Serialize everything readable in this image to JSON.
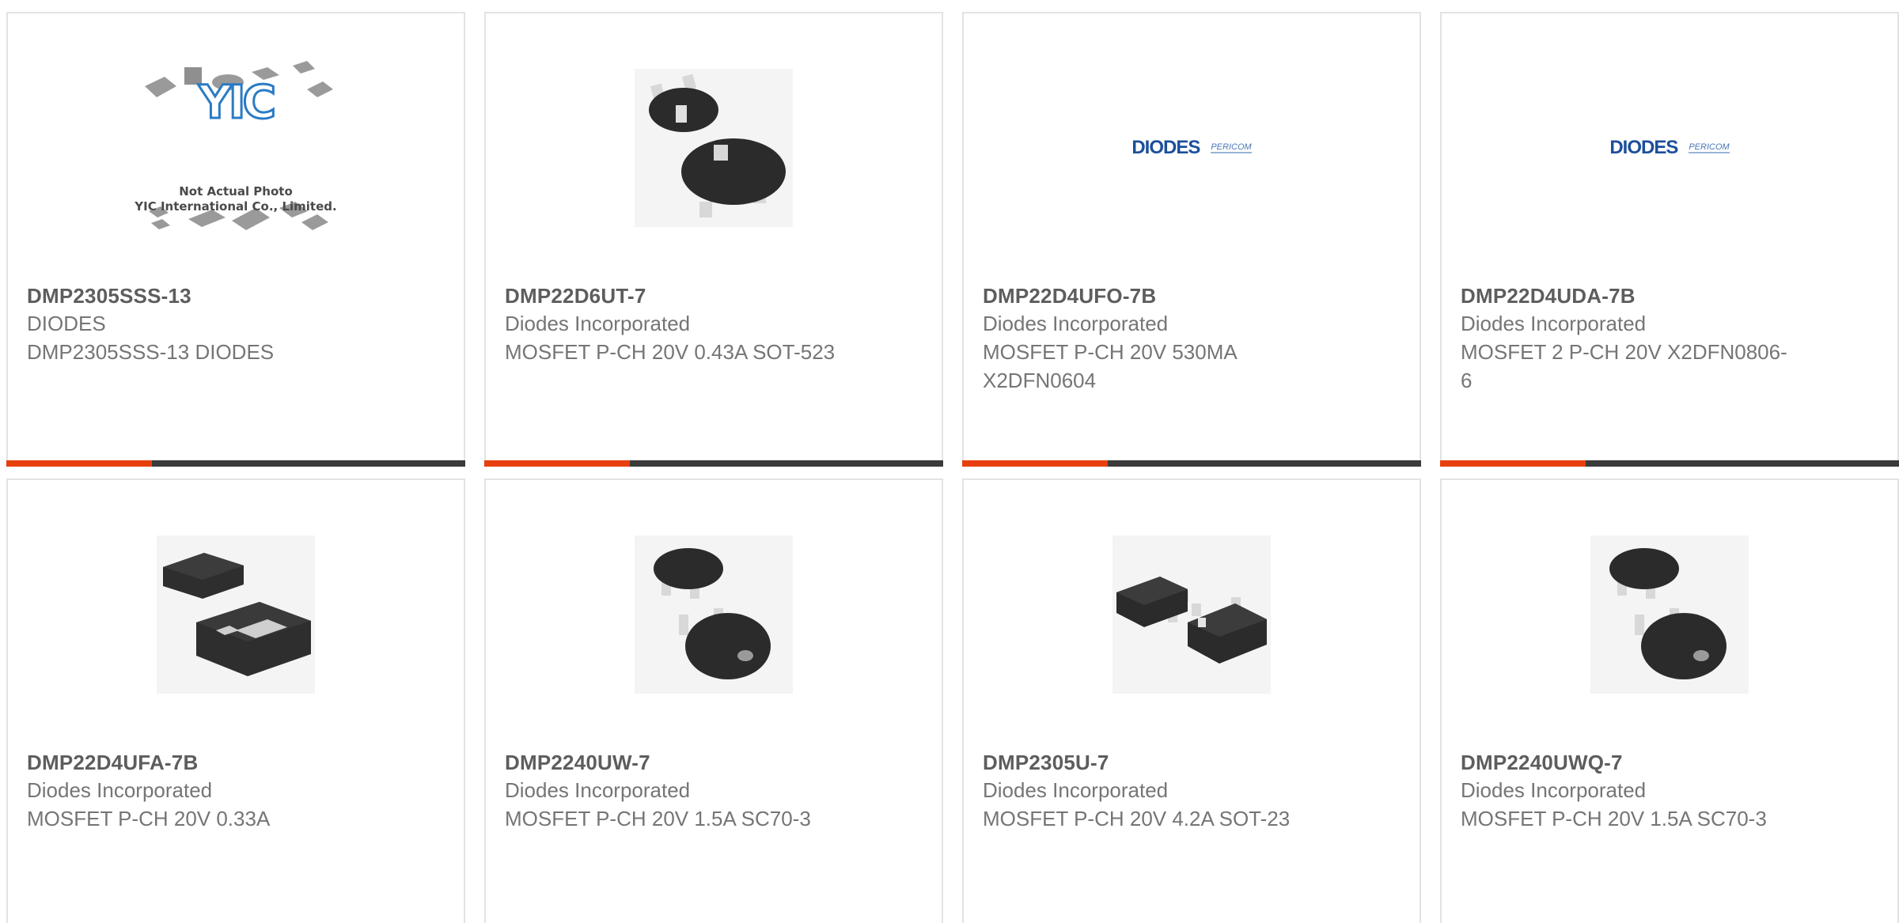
{
  "products": [
    {
      "name": "DMP2305SSS-13",
      "manufacturer": "DIODES",
      "description": "DMP2305SSS-13 DIODES",
      "image": "yic-placeholder",
      "placeholder_line1": "Not Actual Photo",
      "placeholder_line2": "YIC International Co., Limited.",
      "placeholder_logo": "YIC"
    },
    {
      "name": "DMP22D6UT-7",
      "manufacturer": "Diodes Incorporated",
      "description": "MOSFET P-CH 20V 0.43A SOT-523",
      "image": "sot523-package"
    },
    {
      "name": "DMP22D4UFO-7B",
      "manufacturer": "Diodes Incorporated",
      "description": "MOSFET P-CH 20V 530MA X2DFN0604",
      "image": "diodes-pericom-logo",
      "logo_left": "DIODES",
      "logo_right": "PERICOM"
    },
    {
      "name": "DMP22D4UDA-7B",
      "manufacturer": "Diodes Incorporated",
      "description": "MOSFET 2 P-CH 20V X2DFN0806-6",
      "image": "diodes-pericom-logo",
      "logo_left": "DIODES",
      "logo_right": "PERICOM"
    },
    {
      "name": "DMP22D4UFA-7B",
      "manufacturer": "Diodes Incorporated",
      "description": "MOSFET P-CH 20V 0.33A",
      "image": "dfn-package"
    },
    {
      "name": "DMP2240UW-7",
      "manufacturer": "Diodes Incorporated",
      "description": "MOSFET P-CH 20V 1.5A SC70-3",
      "image": "sc70-package"
    },
    {
      "name": "DMP2305U-7",
      "manufacturer": "Diodes Incorporated",
      "description": "MOSFET P-CH 20V 4.2A SOT-23",
      "image": "sot23-package"
    },
    {
      "name": "DMP2240UWQ-7",
      "manufacturer": "Diodes Incorporated",
      "description": "MOSFET P-CH 20V 1.5A SC70-3",
      "image": "sc70-package"
    }
  ],
  "colors": {
    "accent": "#e8400d",
    "bar": "#3b3b3b",
    "border": "#e3e3e3",
    "logo_blue": "#1d4f9c"
  }
}
